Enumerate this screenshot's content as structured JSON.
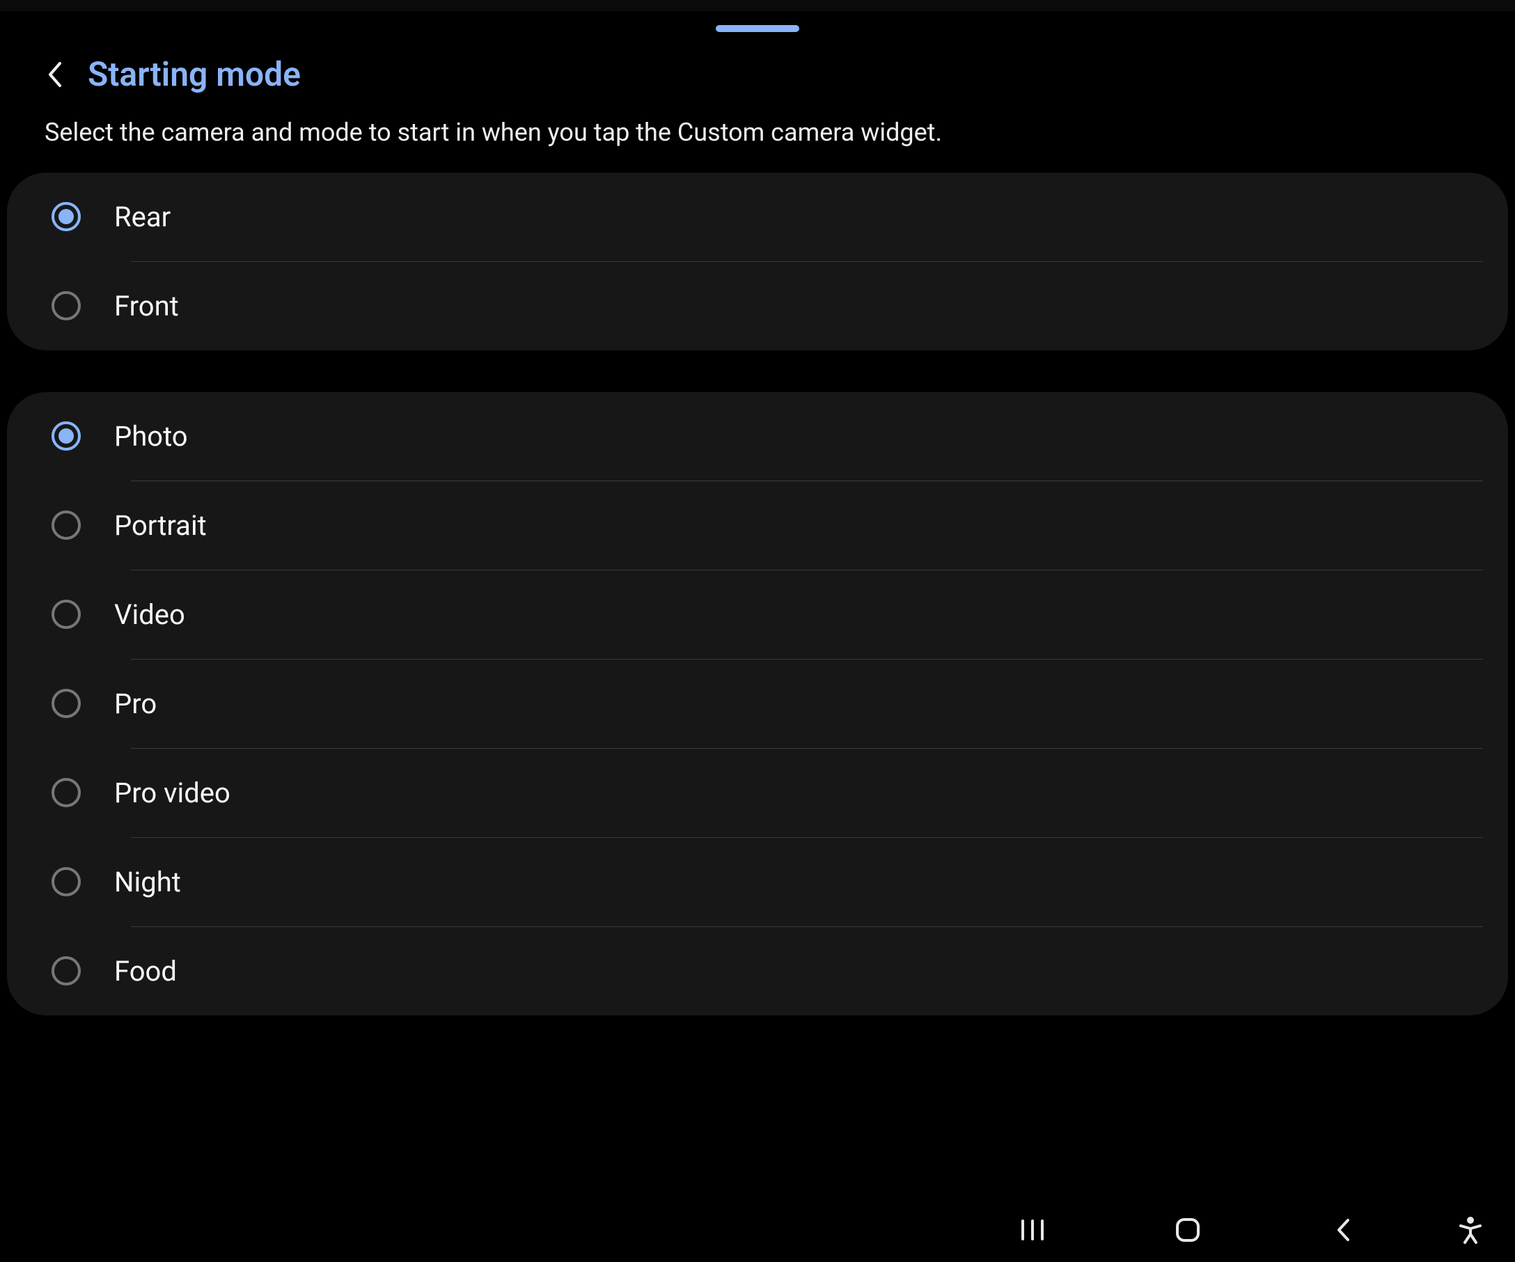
{
  "header": {
    "title": "Starting mode"
  },
  "description": "Select the camera and mode to start in when you tap the Custom camera widget.",
  "cameraOptions": [
    {
      "label": "Rear",
      "selected": true
    },
    {
      "label": "Front",
      "selected": false
    }
  ],
  "modeOptions": [
    {
      "label": "Photo",
      "selected": true
    },
    {
      "label": "Portrait",
      "selected": false
    },
    {
      "label": "Video",
      "selected": false
    },
    {
      "label": "Pro",
      "selected": false
    },
    {
      "label": "Pro video",
      "selected": false
    },
    {
      "label": "Night",
      "selected": false
    },
    {
      "label": "Food",
      "selected": false
    }
  ],
  "colors": {
    "accent": "#8ab4f8",
    "cardBg": "#171717",
    "textPrimary": "#f8f8f8"
  }
}
